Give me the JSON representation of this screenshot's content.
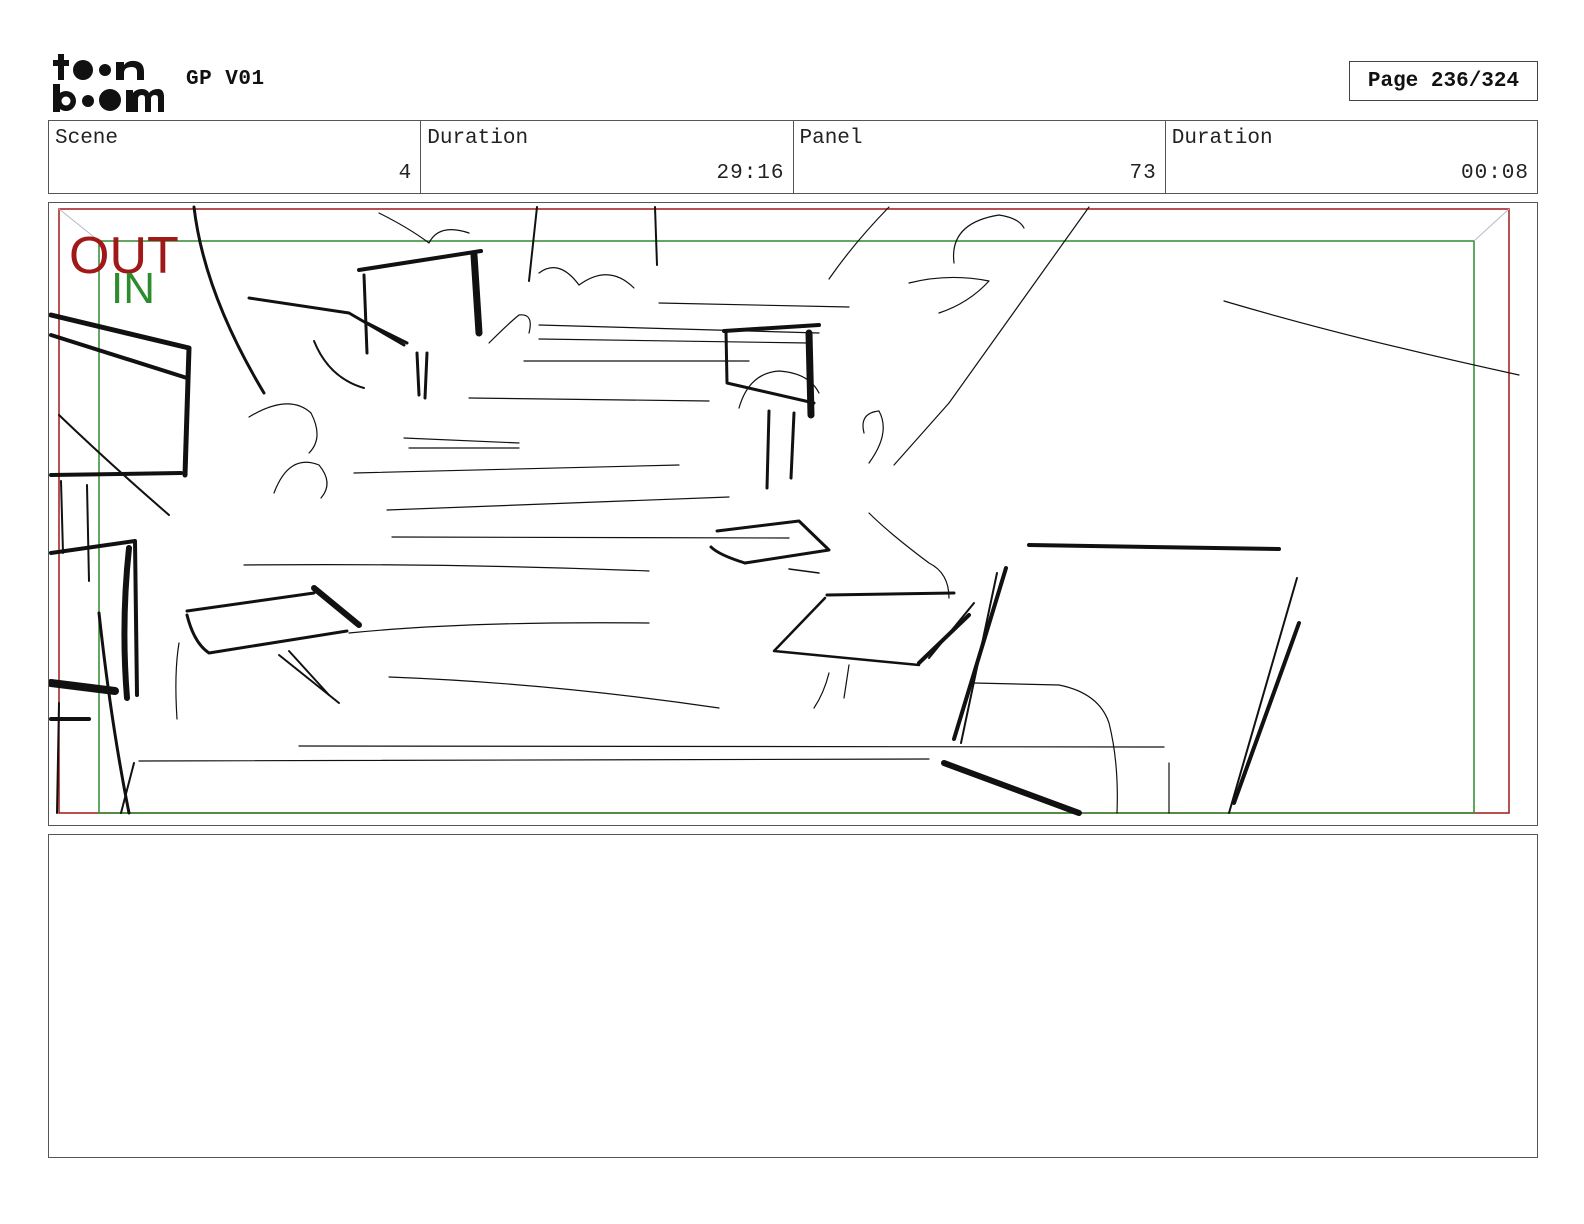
{
  "header": {
    "logo_text": "toon boom",
    "project_title": "GP V01",
    "page_label": "Page 236/324"
  },
  "info": {
    "cells": [
      {
        "label": "Scene",
        "value": "4"
      },
      {
        "label": "Duration",
        "value": "29:16"
      },
      {
        "label": "Panel",
        "value": "73"
      },
      {
        "label": "Duration",
        "value": "00:08"
      }
    ]
  },
  "panel": {
    "frame_out_label": "OUT",
    "frame_in_label": "IN",
    "out_color": "#a01818",
    "in_color": "#2e8b2e"
  },
  "notes": {
    "text": ""
  }
}
